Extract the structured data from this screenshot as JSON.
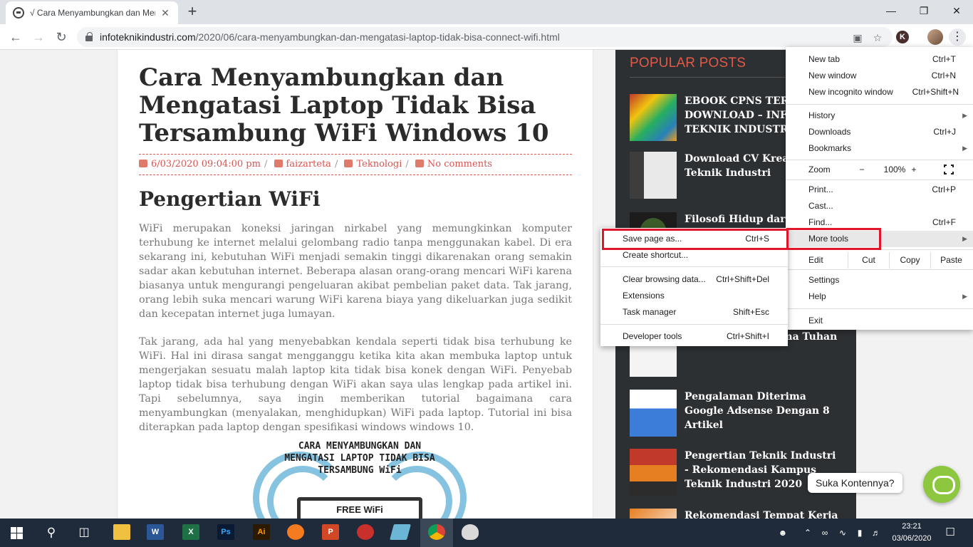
{
  "browser": {
    "tab_title": "√ Cara Menyambungkan dan Mengatasi Laptop",
    "url_host": "infoteknikindustri.com",
    "url_path": "/2020/06/cara-menyambungkan-dan-mengatasi-laptop-tidak-bisa-connect-wifi.html",
    "profile_letter": "K",
    "new_tab_glyph": "+",
    "close_glyph": "✕"
  },
  "article": {
    "title": "Cara Menyambungkan dan Mengatasi Laptop Tidak Bisa Tersambung WiFi Windows 10",
    "date": "6/03/2020 09:04:00 pm",
    "author": "faizarteta",
    "category": "Teknologi",
    "comments": "No comments",
    "section_heading": "Pengertian WiFi",
    "paragraph1": "WiFi merupakan koneksi jaringan nirkabel yang memungkinkan komputer terhubung ke internet melalui gelombang radio tanpa menggunakan kabel. Di era sekarang ini, kebutuhan WiFi menjadi semakin tinggi dikarenakan orang semakin sadar akan kebutuhan internet. Beberapa alasan orang-orang mencari WiFi karena biasanya untuk mengurangi pengeluaran akibat pembelian paket data. Tak jarang, orang lebih suka mencari warung WiFi karena biaya yang dikeluarkan juga sedikit dan kecepatan internet juga lumayan.",
    "paragraph2": "Tak jarang, ada hal yang menyebabkan kendala seperti tidak bisa terhubung ke WiFi. Hal ini dirasa sangat mengganggu ketika kita akan membuka laptop untuk mengerjakan sesuatu malah laptop kita tidak bisa konek dengan WiFi. Penyebab laptop tidak bisa terhubung dengan WiFi akan saya ulas lengkap pada artikel ini. Tapi sebelumnya, saya ingin memberikan tutorial bagaimana cara menyambungkan (menyalakan, menghidupkan) WiFi pada laptop. Tutorial ini bisa diterapkan pada laptop dengan spesifikasi windows windows 10.",
    "hero_caption": "CARA MENYAMBUNGKAN DAN MENGATASI LAPTOP TIDAK BISA TERSAMBUNG WiFi",
    "hero_box": "FREE WiFi"
  },
  "sidebar": {
    "heading": "POPULAR POSTS",
    "posts": [
      {
        "title": "EBOOK CPNS TERBARU DOWNLOAD – INFO TEKNIK INDUSTRI"
      },
      {
        "title": "Download CV Kreatif Teknik Industri"
      },
      {
        "title": "Filosofi Hidup dari Kopi"
      },
      {
        "title": "... dengan Algoritma Tuhan"
      },
      {
        "title": "Pengalaman Diterima Google Adsense Dengan 8 Artikel"
      },
      {
        "title": "Pengertian Teknik Industri - Rekomendasi Kampus Teknik Industri 2020"
      },
      {
        "title": "Rekomendasi Tempat Kerja"
      }
    ]
  },
  "chat": {
    "label": "Suka Kontennya?"
  },
  "menu": {
    "new_tab": "New tab",
    "new_tab_sc": "Ctrl+T",
    "new_window": "New window",
    "new_window_sc": "Ctrl+N",
    "incognito": "New incognito window",
    "incognito_sc": "Ctrl+Shift+N",
    "history": "History",
    "downloads": "Downloads",
    "downloads_sc": "Ctrl+J",
    "bookmarks": "Bookmarks",
    "zoom": "Zoom",
    "zoom_minus": "−",
    "zoom_value": "100%",
    "zoom_plus": "+",
    "print": "Print...",
    "print_sc": "Ctrl+P",
    "cast": "Cast...",
    "find": "Find...",
    "find_sc": "Ctrl+F",
    "more_tools": "More tools",
    "edit": "Edit",
    "cut": "Cut",
    "copy": "Copy",
    "paste": "Paste",
    "settings": "Settings",
    "help": "Help",
    "exit": "Exit",
    "submenu_arrow": "▶"
  },
  "submenu": {
    "save_page": "Save page as...",
    "save_page_sc": "Ctrl+S",
    "create_shortcut": "Create shortcut...",
    "clear_data": "Clear browsing data...",
    "clear_data_sc": "Ctrl+Shift+Del",
    "extensions": "Extensions",
    "task_manager": "Task manager",
    "task_manager_sc": "Shift+Esc",
    "dev_tools": "Developer tools",
    "dev_tools_sc": "Ctrl+Shift+I"
  },
  "taskbar": {
    "word": "W",
    "excel": "X",
    "photoshop": "Ps",
    "illustrator": "Ai",
    "powerpoint": "P",
    "time": "23:21",
    "date": "03/06/2020"
  },
  "colors": {
    "accent_red": "#e05a47",
    "highlight_box": "#e0162b",
    "sidebar_bg": "#2d3033",
    "chat_green": "#8dc63f"
  }
}
